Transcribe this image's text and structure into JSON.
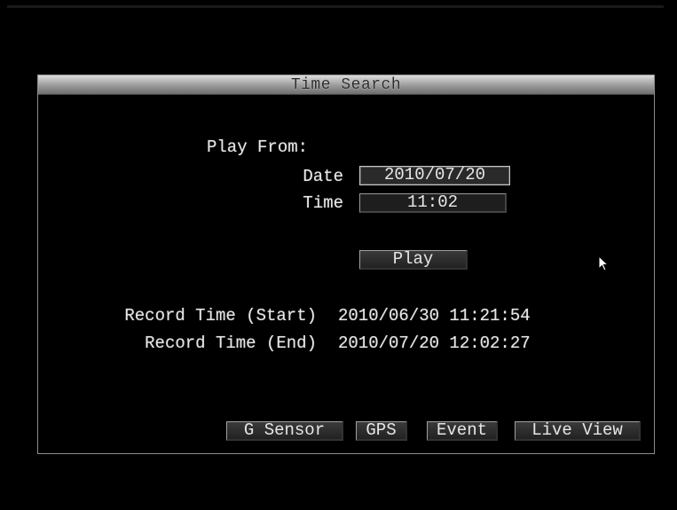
{
  "window": {
    "title": "Time Search"
  },
  "play_from": {
    "heading": "Play From:",
    "date_label": "Date",
    "date_value": "2010/07/20",
    "time_label": "Time",
    "time_value": "11:02",
    "play_button": "Play"
  },
  "record": {
    "start_label": "Record Time (Start)",
    "start_value": "2010/06/30 11:21:54",
    "end_label": "Record Time (End)",
    "end_value": "2010/07/20 12:02:27"
  },
  "footer_buttons": {
    "g_sensor": "G Sensor",
    "gps": "GPS",
    "event": "Event",
    "live_view": "Live View"
  },
  "icons": {
    "cursor": "mouse-pointer-icon"
  },
  "colors": {
    "background": "#000000",
    "text": "#e6e6e6",
    "titlebar": "#9a9a9a",
    "border": "#8c8c8c"
  }
}
